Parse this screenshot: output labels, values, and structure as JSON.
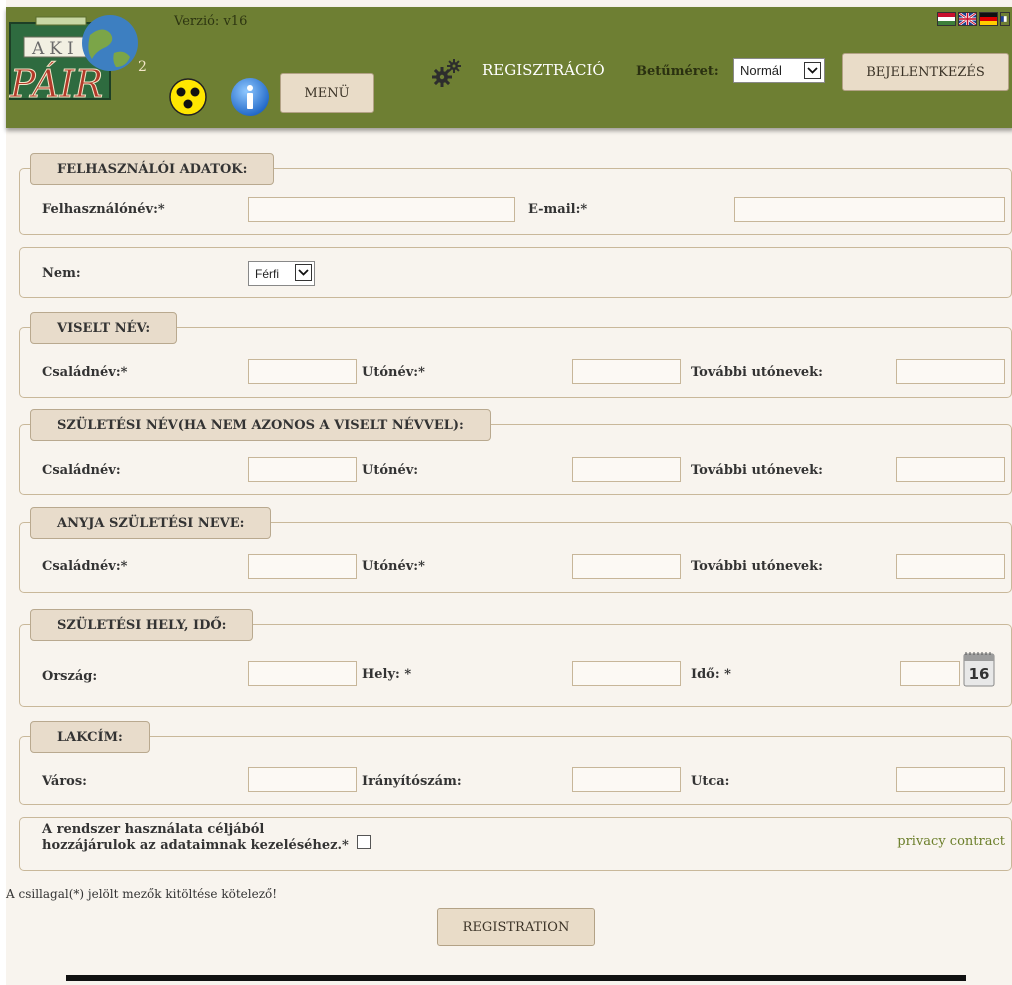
{
  "header": {
    "version": "Verzió: v16",
    "logo_text_top": "AKI",
    "logo_text_main": "PÁIR",
    "logo_superscript": "2",
    "menu_label": "MENÜ",
    "registration_link": "REGISZTRÁCIÓ",
    "font_size_label": "Betűméret:",
    "font_size_selected": "Normál",
    "login_label": "BEJELENTKEZÉS",
    "flags": [
      "hungarian-flag",
      "uk-flag",
      "german-flag",
      "french-flag"
    ],
    "icons": [
      "accessibility-icon",
      "info-icon",
      "gear-icon",
      "globe-icon"
    ]
  },
  "sections": {
    "user": {
      "legend": "FELHASZNÁLÓI ADATOK:",
      "username_label": "Felhasználónév:*",
      "email_label": "E-mail:*"
    },
    "gender": {
      "label": "Nem:",
      "selected": "Férfi"
    },
    "name": {
      "legend": "VISELT NÉV:",
      "family_label": "Családnév:*",
      "given_label": "Utónév:*",
      "other_label": "További utónevek:"
    },
    "birth_name": {
      "legend": "SZÜLETÉSI NÉV(HA NEM AZONOS A VISELT NÉVVEL):",
      "family_label": "Családnév:",
      "given_label": "Utónév:",
      "other_label": "További utónevek:"
    },
    "mother_name": {
      "legend": "ANYJA SZÜLETÉSI NEVE:",
      "family_label": "Családnév:*",
      "given_label": "Utónév:*",
      "other_label": "További utónevek:"
    },
    "birth_place": {
      "legend": "SZÜLETÉSI HELY, IDŐ:",
      "country_label": "Ország:",
      "place_label": "Hely: *",
      "time_label": "Idő: *",
      "calendar_number": "16"
    },
    "address": {
      "legend": "LAKCÍM:",
      "city_label": "Város:",
      "zip_label": "Irányítószám:",
      "street_label": "Utca:"
    },
    "consent": {
      "line1": "A rendszer használata céljából",
      "line2": "hozzájárulok az adataimnak kezeléséhez.*",
      "privacy_link": "privacy contract"
    }
  },
  "footer": {
    "required_note": "A csillagal(*) jelölt mezők kitöltése kötelező!",
    "registration_button": "REGISTRATION"
  },
  "colors": {
    "header_green": "#6e7f33",
    "page_bg": "#f8f4ee",
    "button_bg": "#e9dcc8",
    "link_green": "#6b7e2a"
  }
}
